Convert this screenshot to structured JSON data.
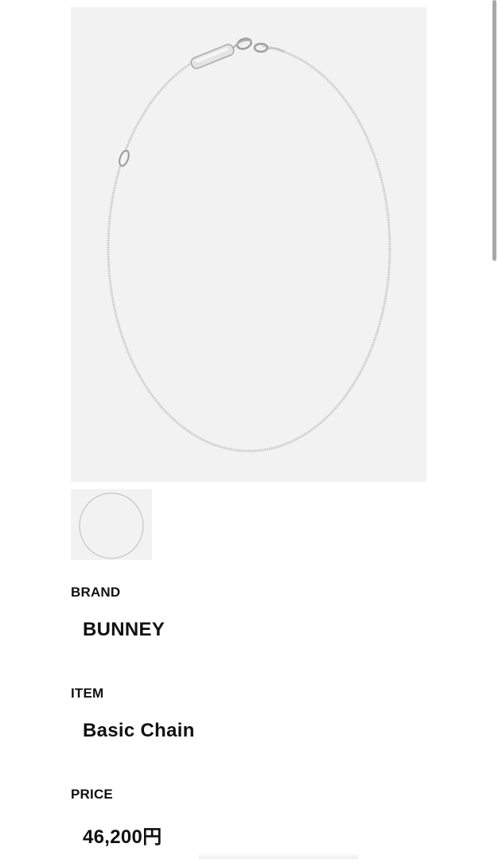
{
  "product": {
    "brand_label": "BRAND",
    "brand_value": "BUNNEY",
    "item_label": "ITEM",
    "item_value": "Basic Chain",
    "price_label": "PRICE",
    "price_value": "46,200円"
  },
  "images": {
    "main": "silver-chain-necklace-photo",
    "thumbnails": [
      "silver-chain-necklace-thumbnail"
    ]
  },
  "colors": {
    "image_background": "#f2f2f2",
    "text": "#111111",
    "chain": "#c4c4c4"
  }
}
